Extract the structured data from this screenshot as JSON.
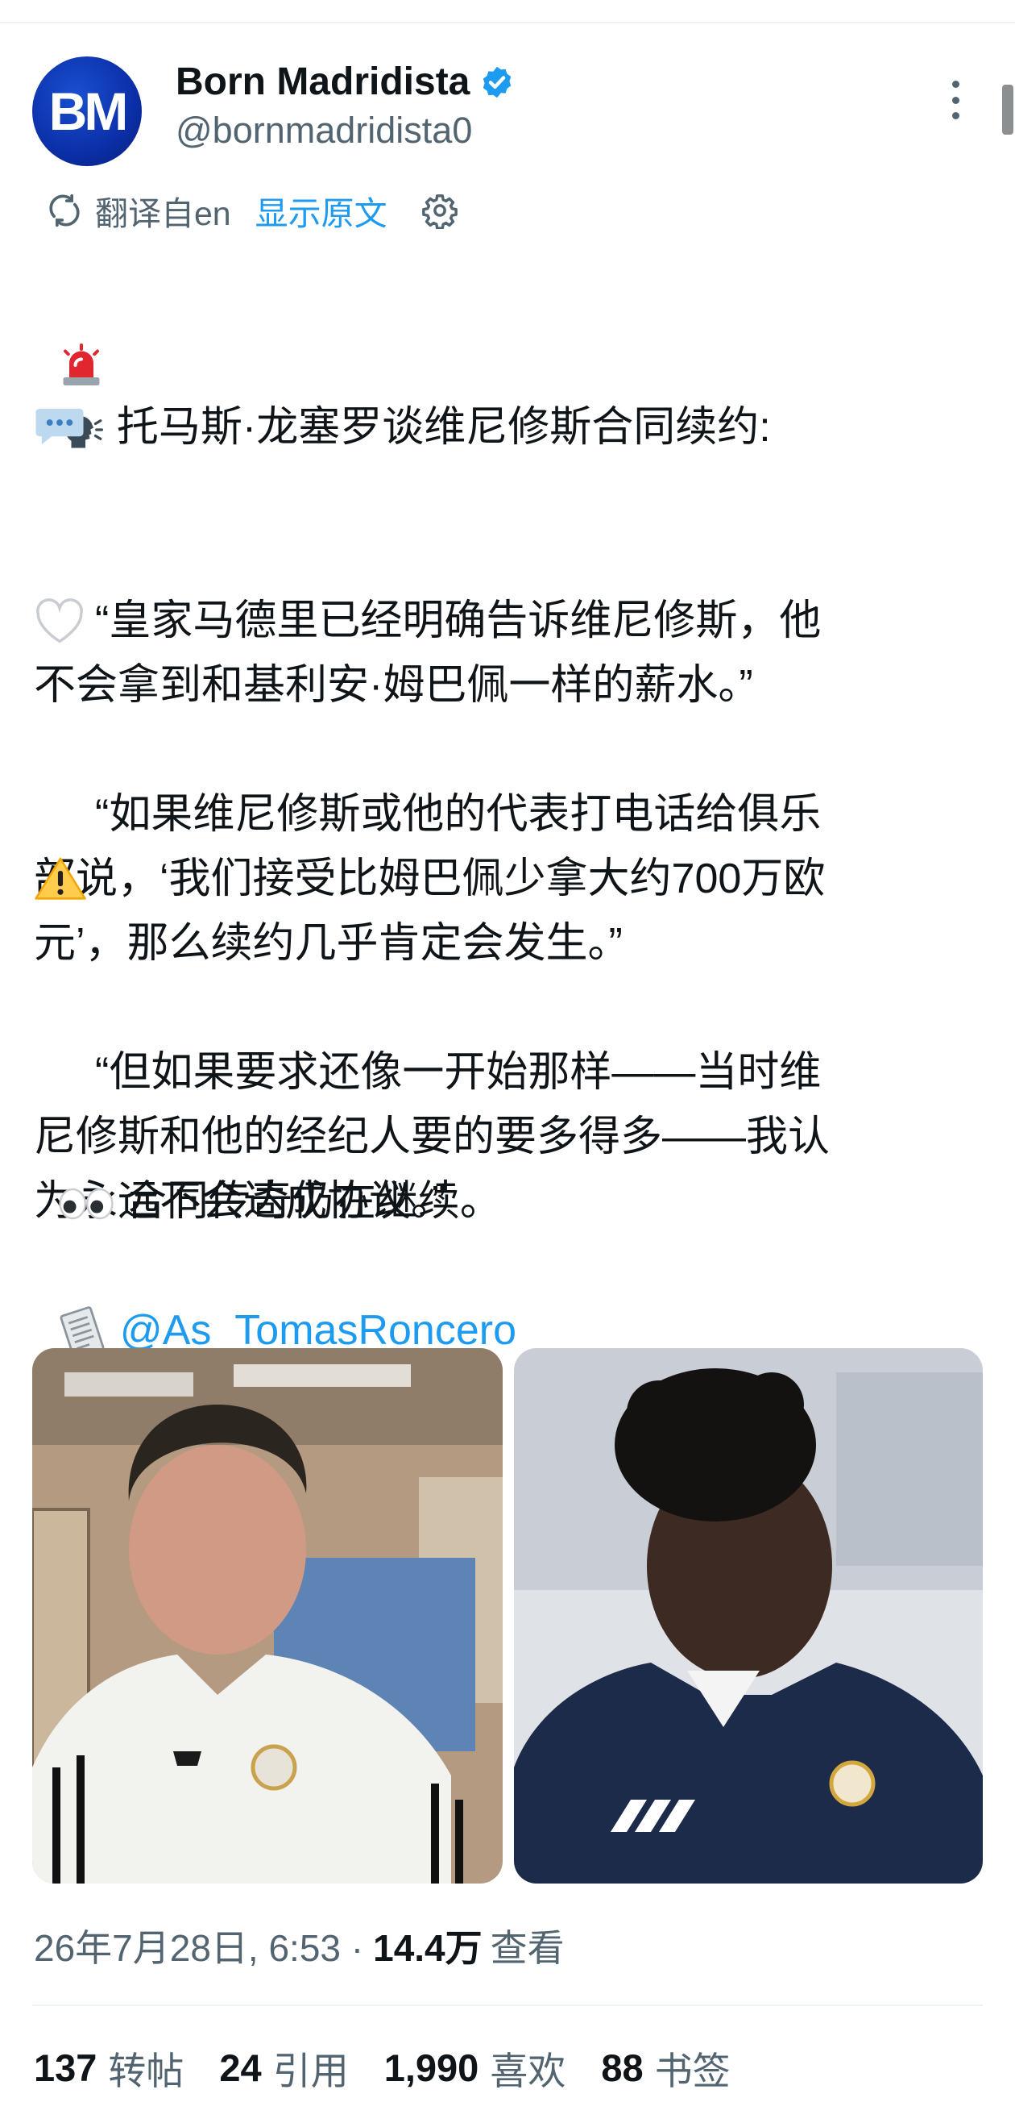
{
  "author": {
    "avatar_text": "BM",
    "display_name": "Born Madridista",
    "handle": "@bornmadridista0",
    "verified": true
  },
  "translation": {
    "translated_from": "翻译自en",
    "show_original": "显示原文"
  },
  "tweet": {
    "line1_text": "托马斯·龙塞罗谈维尼修斯合同续约:",
    "para1": "“皇家马德里已经明确告诉维尼修斯，他\n不会拿到和基利安·姆巴佩一样的薪水。”",
    "para2": "“如果维尼修斯或他的代表打电话给俱乐\n部说，‘我们接受比姆巴佩少拿大约700万欧\n元’，那么续约几乎肯定会发生。”",
    "para3": "“但如果要求还像一开始那样——当时维\n尼修斯和他的经纪人要的要多得多——我认\n为永远不会达成协议。”",
    "para4": "合同传奇仍在继续。",
    "source_mention": "@As_TomasRoncero"
  },
  "media": [
    {
      "description": "photo-tomas-roncero"
    },
    {
      "description": "photo-vinicius"
    }
  ],
  "meta": {
    "timestamp": "26年7月28日, 6:53 ·",
    "views": "14.4万",
    "views_label": "查看"
  },
  "stats": {
    "retweets": "137",
    "retweets_label": "转帖",
    "quotes": "24",
    "quotes_label": "引用",
    "likes": "1,990",
    "likes_label": "喜欢",
    "bookmarks": "88",
    "bookmarks_label": "书签"
  },
  "colors": {
    "accent": "#1d9bf0",
    "text": "#0f1419",
    "secondary": "#536471"
  },
  "icons": [
    "siren-icon",
    "speaking-head-icon",
    "speech-bubble-icon",
    "white-heart-icon",
    "warning-icon",
    "eyes-icon",
    "newspaper-icon",
    "verified-badge-icon",
    "translate-icon",
    "gear-icon",
    "more-options-icon"
  ]
}
